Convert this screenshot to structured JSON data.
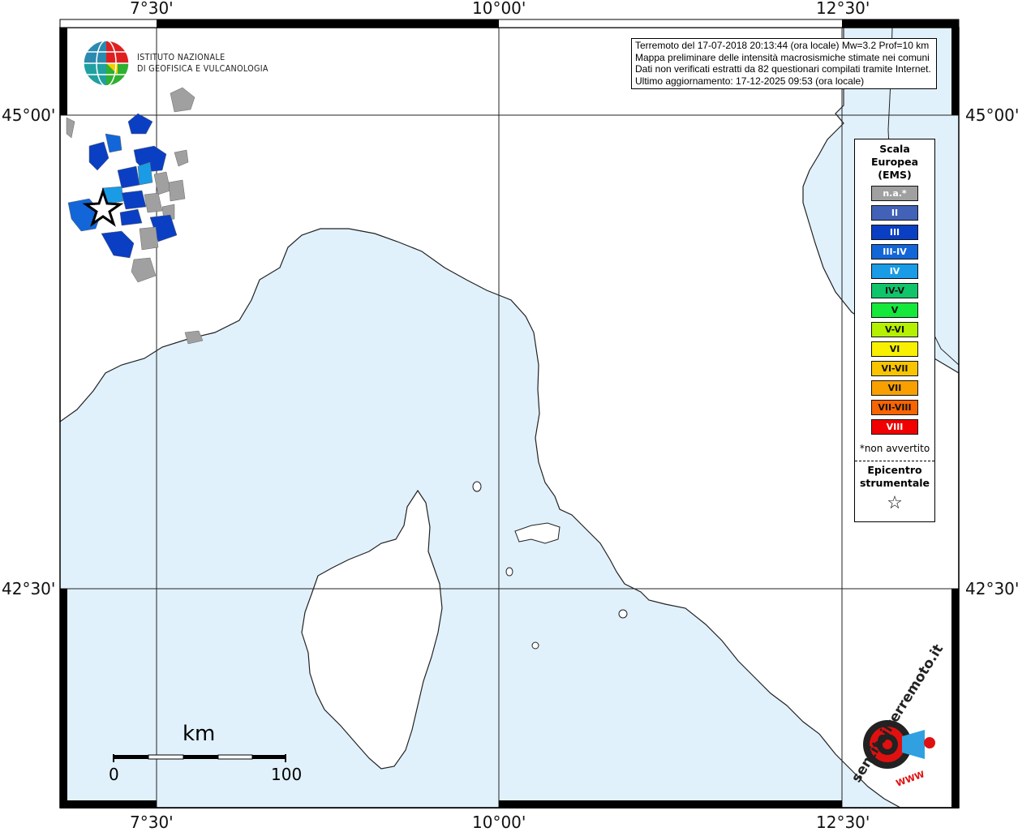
{
  "map": {
    "lon_ticks_top": [
      "7°30'",
      "10°00'",
      "12°30'"
    ],
    "lon_ticks_bottom": [
      "7°30'",
      "10°00'",
      "12°30'"
    ],
    "lat_ticks_left": [
      "45°00'",
      "42°30'"
    ],
    "lat_ticks_right": [
      "45°00'",
      "42°30'"
    ],
    "colors": {
      "sea": "#e1f1fc",
      "land": "#ffffff",
      "na": "#a0a0a0",
      "II": "#4262b8",
      "III": "#0a3fc4",
      "III-IV": "#1266d8",
      "IV": "#1a9be6"
    }
  },
  "logo": {
    "line1": "ISTITUTO NAZIONALE",
    "line2": "DI GEOFISICA E VULCANOLOGIA"
  },
  "info": {
    "line1": "Terremoto del 17-07-2018 20:13:44 (ora locale) Mw=3.2 Prof=10 km",
    "line2": "Mappa preliminare delle intensità macrosismiche stimate nei comuni",
    "line3": "Dati non verificati estratti da 82 questionari compilati tramite Internet.",
    "line4": "Ultimo aggiornamento: 17-12-2025 09:53 (ora locale)"
  },
  "legend": {
    "title1": "Scala",
    "title2": "Europea",
    "title3": "(EMS)",
    "items": [
      {
        "label": "n.a.*",
        "color": "#a0a0a0",
        "text": "#ffffff"
      },
      {
        "label": "II",
        "color": "#4262b8",
        "text": "#ffffff"
      },
      {
        "label": "III",
        "color": "#0a3fc4",
        "text": "#ffffff"
      },
      {
        "label": "III-IV",
        "color": "#1266d8",
        "text": "#ffffff"
      },
      {
        "label": "IV",
        "color": "#1a9be6",
        "text": "#ffffff"
      },
      {
        "label": "IV-V",
        "color": "#10c46a",
        "text": "#111111"
      },
      {
        "label": "V",
        "color": "#14e83a",
        "text": "#111111"
      },
      {
        "label": "V-VI",
        "color": "#b4f000",
        "text": "#111111"
      },
      {
        "label": "VI",
        "color": "#f8f000",
        "text": "#111111"
      },
      {
        "label": "VI-VII",
        "color": "#f8c400",
        "text": "#111111"
      },
      {
        "label": "VII",
        "color": "#f8a000",
        "text": "#111111"
      },
      {
        "label": "VII-VIII",
        "color": "#f86400",
        "text": "#111111"
      },
      {
        "label": "VIII",
        "color": "#f00000",
        "text": "#ffffff"
      }
    ],
    "note": "*non avvertito",
    "epicentre1": "Epicentro",
    "epicentre2": "strumentale",
    "epicentre_symbol": "☆"
  },
  "scalebar": {
    "unit": "km",
    "start": "0",
    "end": "100"
  },
  "badge": {
    "text": "sentitoilterremoto.it",
    "url": "WWW"
  }
}
